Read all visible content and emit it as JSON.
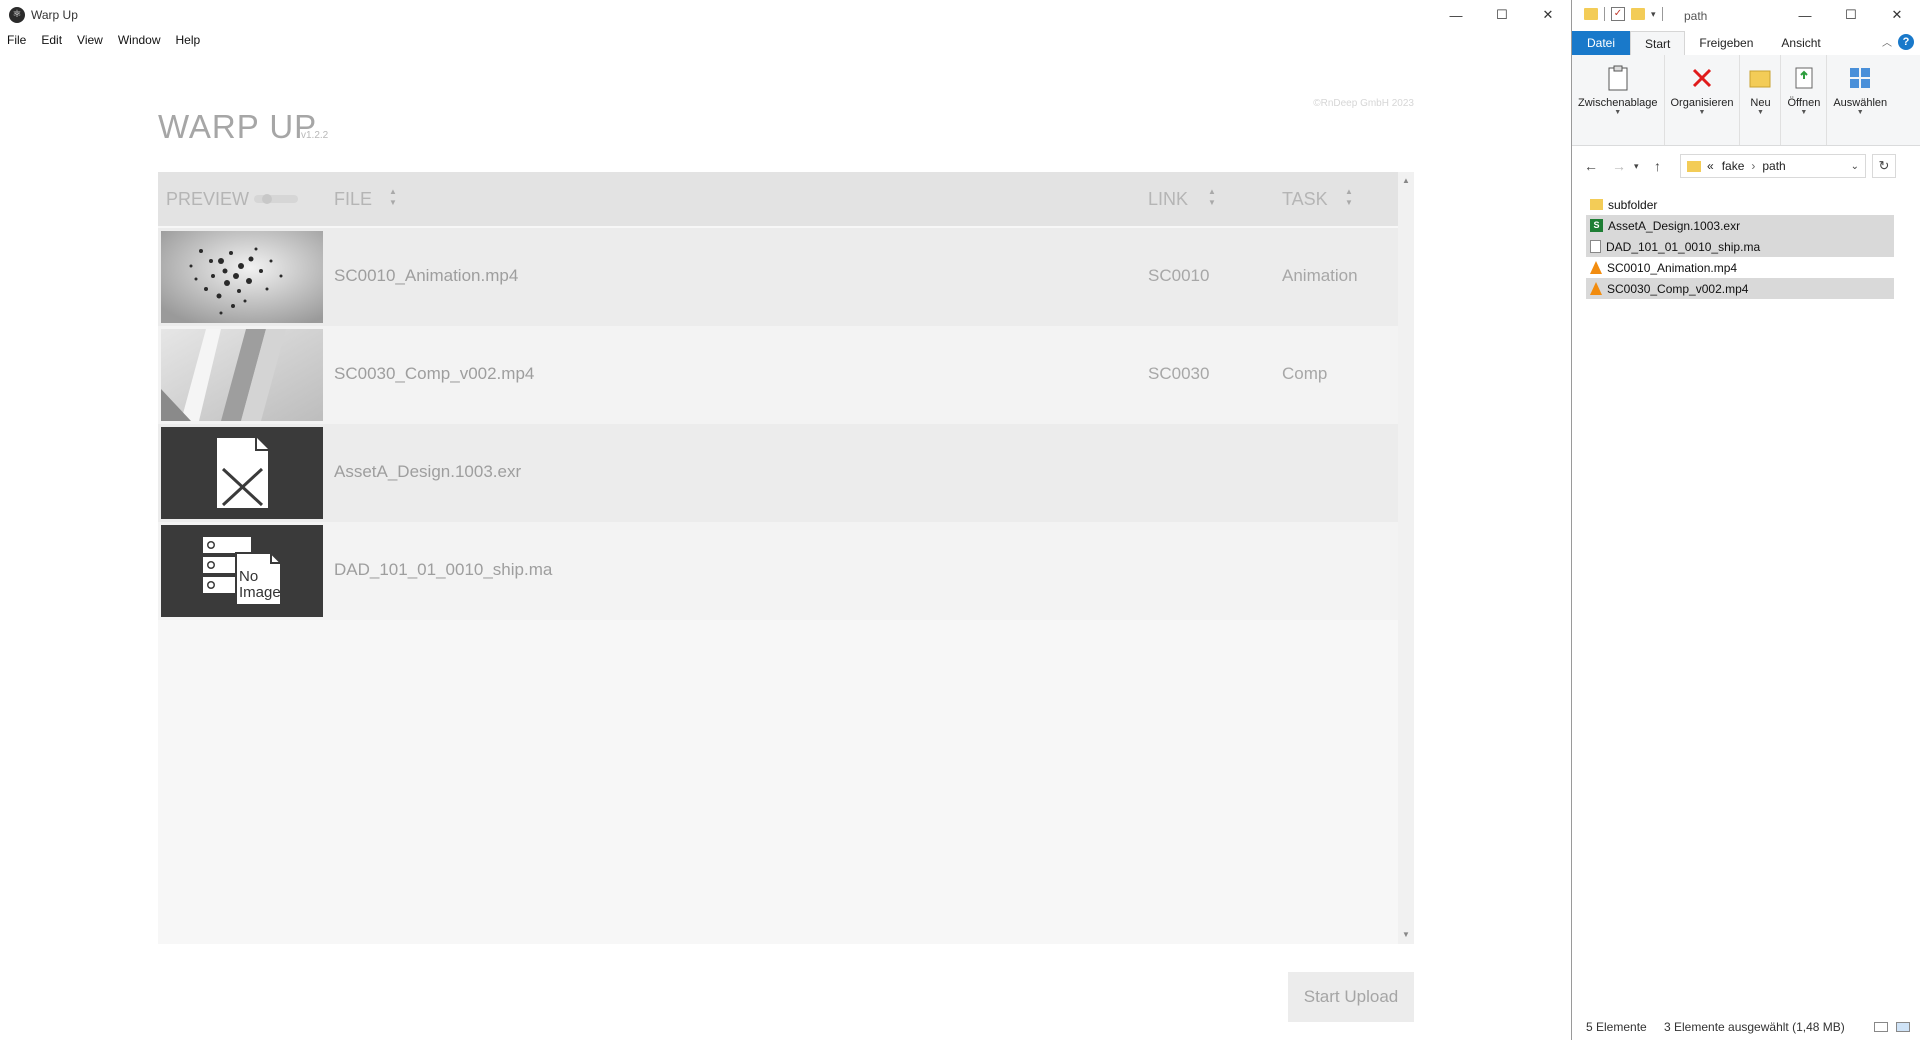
{
  "warp_window": {
    "title": "Warp Up",
    "controls": {
      "minimize": "—",
      "maximize": "☐",
      "close": "✕"
    },
    "menu": [
      "File",
      "Edit",
      "View",
      "Window",
      "Help"
    ],
    "app_title": "WARP UP",
    "version": "v1.2.2",
    "copyright": "©RnDeep GmbH 2023",
    "table": {
      "columns": {
        "preview": "PREVIEW",
        "file": "FILE",
        "link": "LINK",
        "task": "TASK"
      },
      "rows": [
        {
          "file": "SC0010_Animation.mp4",
          "link": "SC0010",
          "task": "Animation",
          "thumb": "particles"
        },
        {
          "file": "SC0030_Comp_v002.mp4",
          "link": "SC0030",
          "task": "Comp",
          "thumb": "abstract-shapes"
        },
        {
          "file": "AssetA_Design.1003.exr",
          "link": "",
          "task": "",
          "thumb": "broken-image"
        },
        {
          "file": "DAD_101_01_0010_ship.ma",
          "link": "",
          "task": "",
          "thumb": "no-image"
        }
      ],
      "no_image_text": [
        "No",
        "Image"
      ]
    },
    "upload_button": "Start Upload"
  },
  "explorer": {
    "title": "path",
    "controls": {
      "minimize": "—",
      "maximize": "☐",
      "close": "✕"
    },
    "tabs": {
      "file": "Datei",
      "start": "Start",
      "share": "Freigeben",
      "view": "Ansicht"
    },
    "ribbon": {
      "clipboard": "Zwischenablage",
      "organize": "Organisieren",
      "new": "Neu",
      "open": "Öffnen",
      "select": "Auswählen"
    },
    "address": {
      "prefix": "«",
      "parts": [
        "fake",
        "path"
      ]
    },
    "files": [
      {
        "name": "subfolder",
        "type": "folder",
        "selected": false
      },
      {
        "name": "AssetA_Design.1003.exr",
        "type": "exr",
        "selected": true
      },
      {
        "name": "DAD_101_01_0010_ship.ma",
        "type": "doc",
        "selected": true
      },
      {
        "name": "SC0010_Animation.mp4",
        "type": "vlc",
        "selected": false
      },
      {
        "name": "SC0030_Comp_v002.mp4",
        "type": "vlc",
        "selected": true
      }
    ],
    "status": {
      "count": "5 Elemente",
      "selected": "3 Elemente ausgewählt (1,48 MB)"
    },
    "help": "?"
  }
}
